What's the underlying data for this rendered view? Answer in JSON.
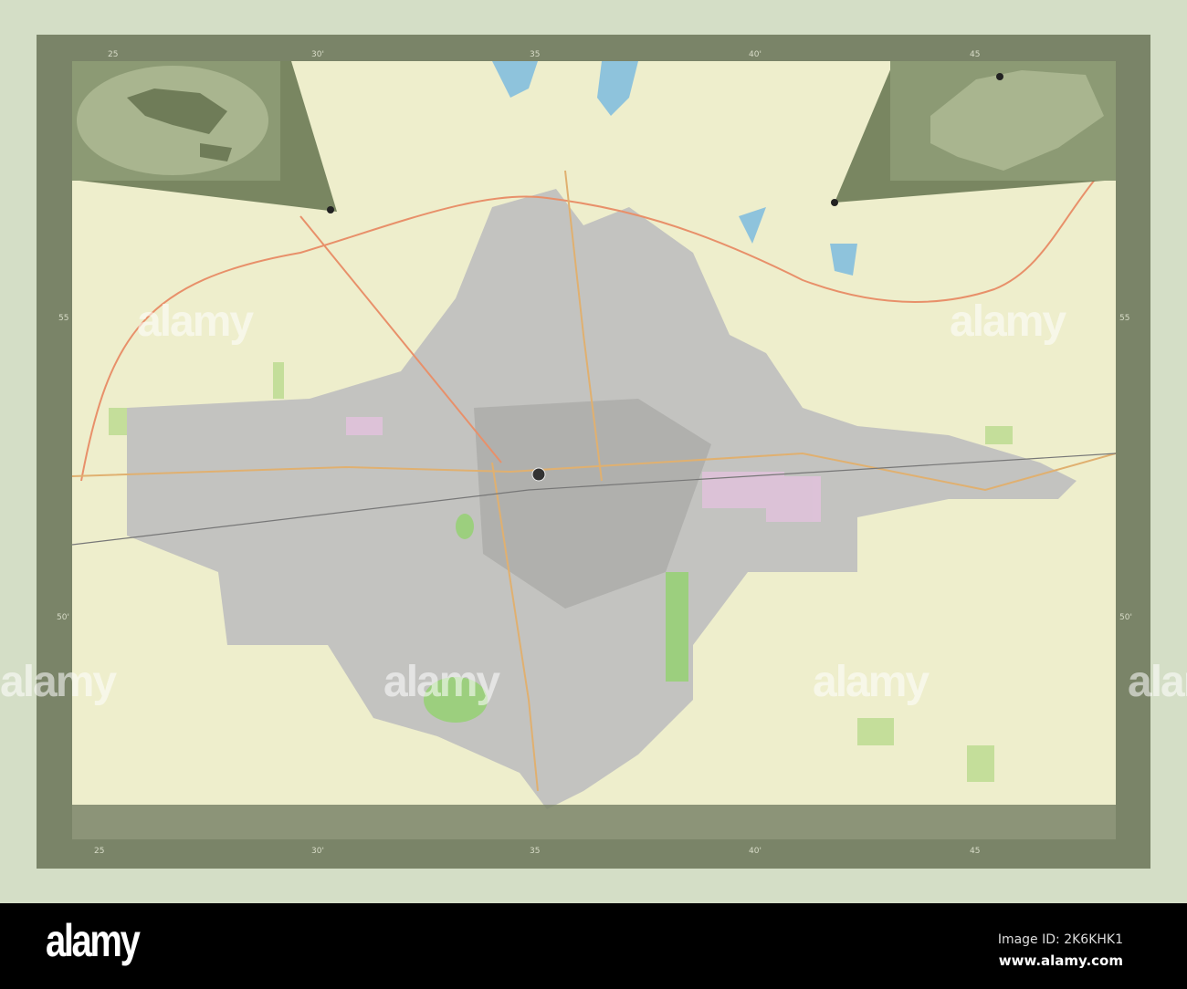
{
  "map": {
    "ticks_top": [
      "25",
      "30'",
      "35",
      "40'",
      "45"
    ],
    "ticks_bottom": [
      "25",
      "30'",
      "35",
      "40'",
      "45"
    ],
    "ticks_left": [
      "55",
      "50'"
    ],
    "ticks_right": [
      "55",
      "50'"
    ],
    "colors": {
      "background": "#eeeecc",
      "urban": "#bdbdbd",
      "frame": "#7a8468",
      "water": "#8ec3dc",
      "roads": "#e8906a"
    }
  },
  "watermark": "alamy",
  "banner": {
    "logo": "alamy",
    "image_id": "Image ID: 2K6KHK1",
    "site": "www.alamy.com"
  }
}
